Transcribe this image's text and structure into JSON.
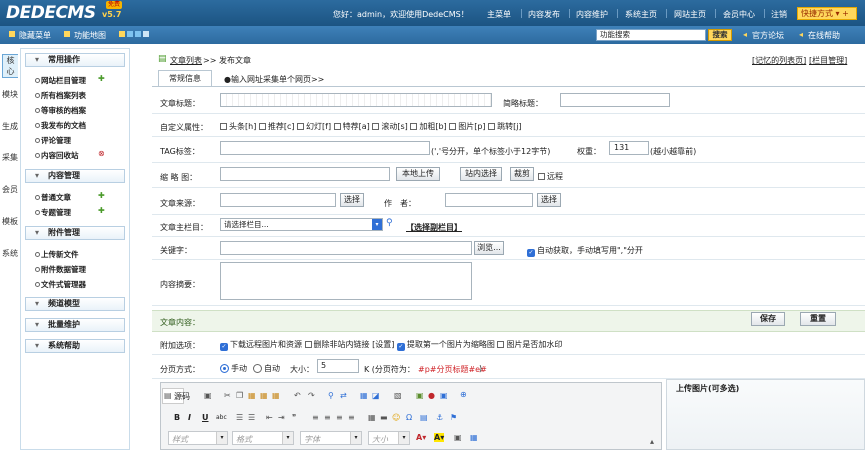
{
  "header": {
    "logo": "DEDECMS",
    "version": "v5.7",
    "badge": "免费",
    "welcome": "您好：admin，欢迎使用DedeCMS！",
    "nav": [
      "主菜单",
      "内容发布",
      "内容维护",
      "系统主页",
      "网站主页",
      "会员中心",
      "注销"
    ],
    "shortcut": "快捷方式 ▾ +"
  },
  "subbar": {
    "hide_menu": "隐藏菜单",
    "func_map": "功能地图",
    "search_value": "功能搜索",
    "search_btn": "搜索",
    "forum": "官方论坛",
    "help": "在线帮助"
  },
  "side_tabs": [
    "核心",
    "模块",
    "生成",
    "采集",
    "会员",
    "模板",
    "系统"
  ],
  "menu": {
    "sections": [
      "常用操作",
      "内容管理",
      "附件管理",
      "频道模型",
      "批量维护",
      "系统帮助"
    ],
    "common": [
      "网站栏目管理",
      "所有档案列表",
      "等审核的档案",
      "我发布的文档",
      "评论管理",
      "内容回收站"
    ],
    "content": [
      "普通文章",
      "专题管理"
    ],
    "attach": [
      "上传新文件",
      "附件数据管理",
      "文件式管理器"
    ]
  },
  "breadcrumb": {
    "list": "文章列表",
    "rest": ">> 发布文章"
  },
  "right_links": [
    "[记忆的列表页]",
    "[栏目管理]"
  ],
  "tabs": {
    "normal": "常规信息",
    "import": "●输入网址采集单个网页>>"
  },
  "form": {
    "title_label": "文章标题：",
    "short_title_label": "简略标题：",
    "custom_attr_label": "自定义属性：",
    "attrs": [
      "头条[h]",
      "推荐[c]",
      "幻灯[f]",
      "特荐[a]",
      "滚动[s]",
      "加粗[b]",
      "图片[p]",
      "跳转[j]"
    ],
    "tag_label": "TAG标签：",
    "tag_hint": "(','号分开，单个标签小于12字节)",
    "weight_label": "权重：",
    "weight_value": "131",
    "weight_hint": "(越小越靠前)",
    "thumb_label": "缩 略 图：",
    "local_upload": "本地上传",
    "site_select": "站内选择",
    "crop": "裁剪",
    "remote": "远程",
    "source_label": "文章来源：",
    "select": "选择",
    "author_label": "作　者：",
    "column_label": "文章主栏目：",
    "column_value": "请选择栏目...",
    "sub_column": "【选择副栏目】",
    "keyword_label": "关键字：",
    "browse": "浏览...",
    "auto_get": "自动获取，手动填写用\",\"分开",
    "summary_label": "内容摘要："
  },
  "content_bar": {
    "label": "文章内容：",
    "save": "保存",
    "reset": "重置"
  },
  "extra": {
    "label": "附加选项：",
    "opts": [
      "下载远程图片和资源",
      "删除非站内链接",
      "[设置]",
      "提取第一个图片为缩略图",
      "图片是否加水印"
    ]
  },
  "paging": {
    "label": "分页方式：",
    "manual": "手动",
    "auto": "自动",
    "size_label": "大小：",
    "size_value": "5",
    "unit": "K (分页符为：",
    "sep": "#p#分页标题#e#",
    "close": ")"
  },
  "editor": {
    "source": "源码",
    "style": "样式",
    "format": "格式",
    "font": "字体",
    "size": "大小"
  },
  "upload_panel": {
    "title": "上传图片(可多选)"
  }
}
